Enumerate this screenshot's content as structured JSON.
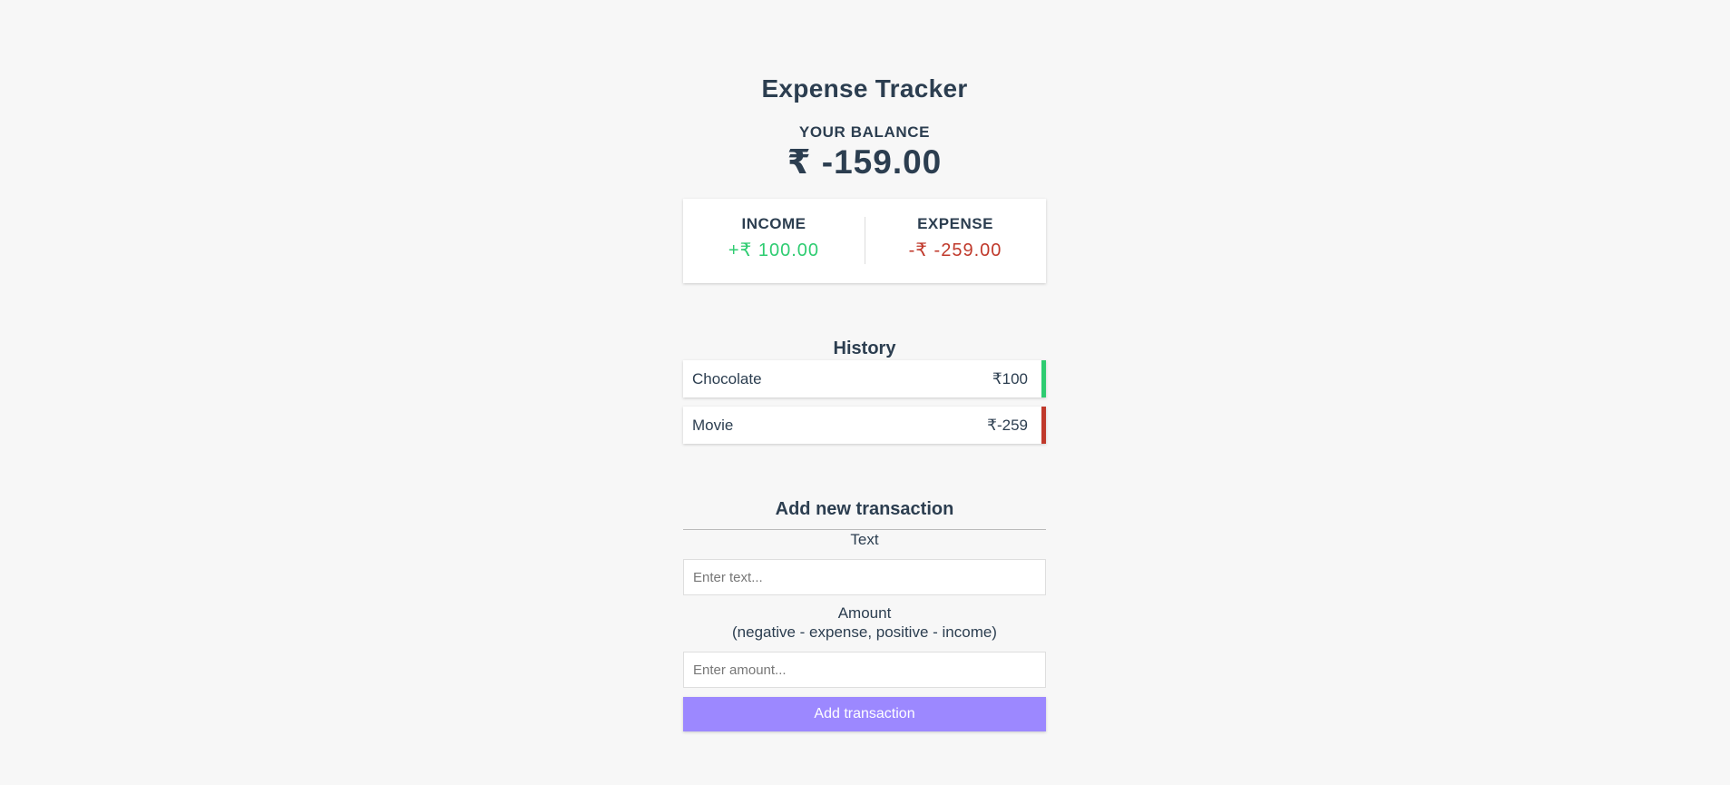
{
  "app": {
    "title": "Expense Tracker"
  },
  "balance": {
    "label": "YOUR BALANCE",
    "value": "₹ -159.00"
  },
  "summary": {
    "income_label": "INCOME",
    "income_value": "+₹ 100.00",
    "expense_label": "EXPENSE",
    "expense_value": "-₹ -259.00"
  },
  "history": {
    "title": "History",
    "items": [
      {
        "text": "Chocolate",
        "amount": "₹100",
        "type": "plus"
      },
      {
        "text": "Movie",
        "amount": "₹-259",
        "type": "minus"
      }
    ]
  },
  "form": {
    "title": "Add new transaction",
    "text_label": "Text",
    "text_placeholder": "Enter text...",
    "text_value": "",
    "amount_label_line1": "Amount",
    "amount_label_line2": "(negative - expense, positive - income)",
    "amount_placeholder": "Enter amount...",
    "amount_value": "",
    "submit_label": "Add transaction"
  },
  "colors": {
    "background": "#f7f7f7",
    "text": "#2c3e50",
    "income": "#2ecc71",
    "expense": "#c0392b",
    "button": "#9c88ff"
  }
}
